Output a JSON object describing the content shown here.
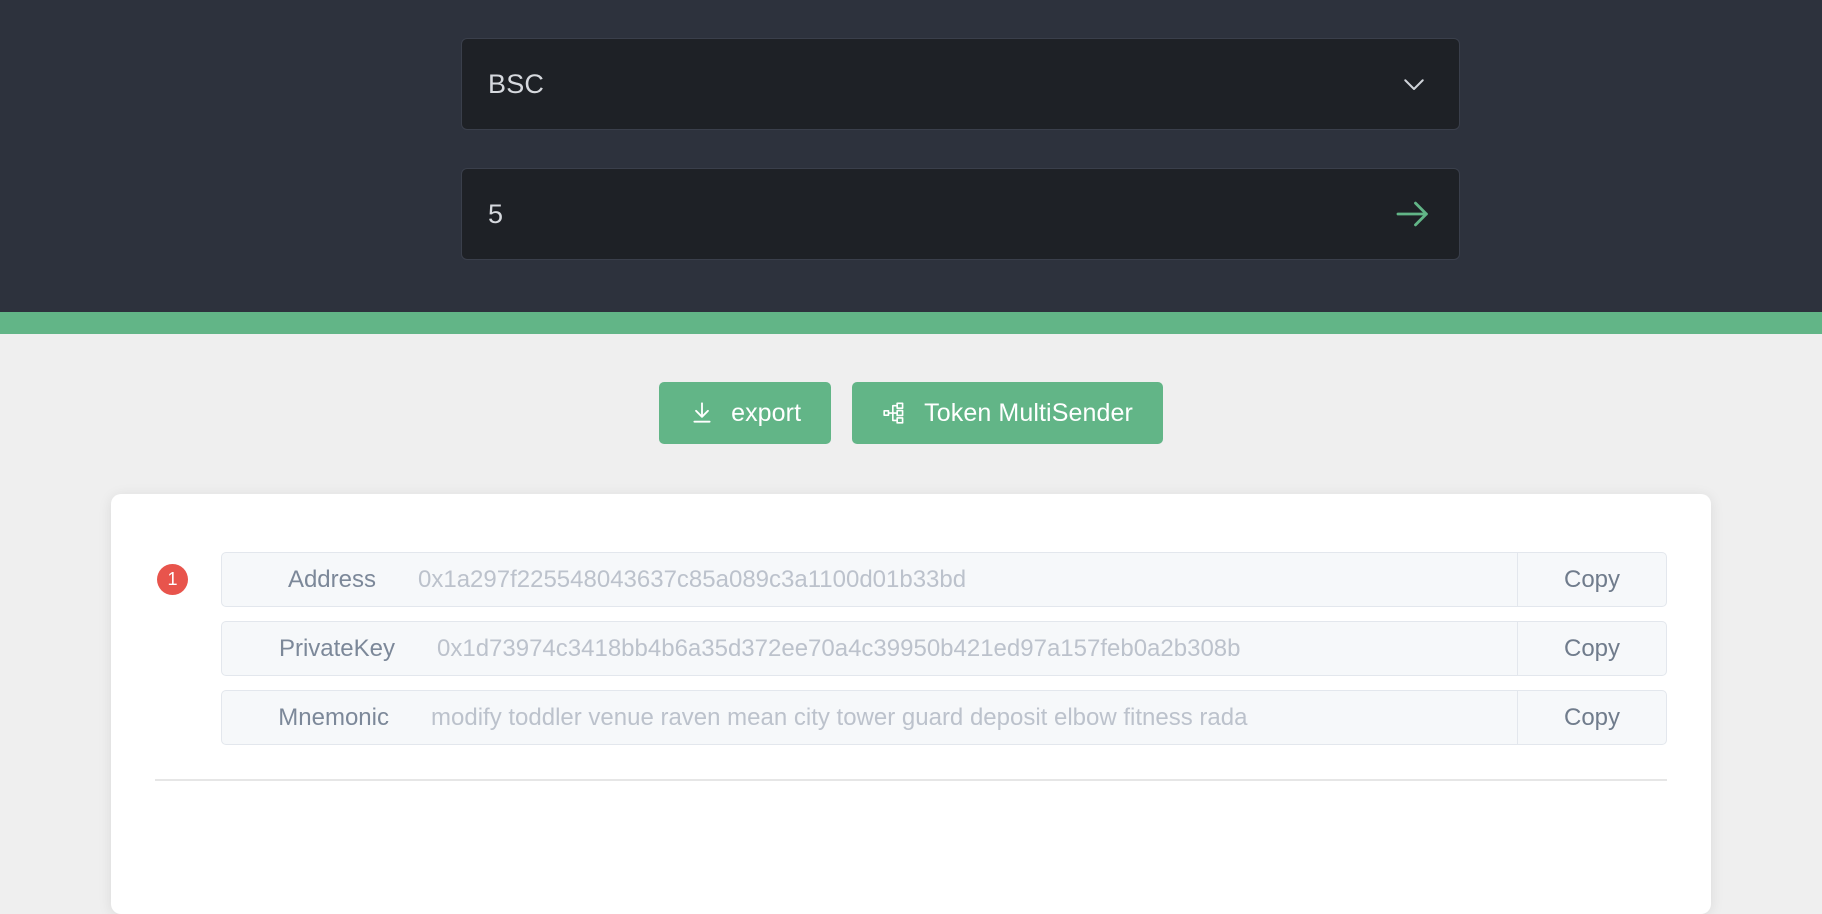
{
  "header": {
    "network_select": {
      "value": "BSC",
      "icon": "chevron-down-icon"
    },
    "count_input": {
      "value": "5",
      "submit_icon": "arrow-right-icon"
    }
  },
  "toolbar": {
    "export_label": "export",
    "export_icon": "download-icon",
    "multisender_label": "Token MultiSender",
    "multisender_icon": "sitemap-icon"
  },
  "wallets": [
    {
      "index": "1",
      "rows": [
        {
          "label": "Address",
          "value": "0x1a297f225548043637c85a089c3a1100d01b33bd",
          "copy_label": "Copy"
        },
        {
          "label": "PrivateKey",
          "value": "0x1d73974c3418bb4b6a35d372ee70a4c39950b421ed97a157feb0a2b308b",
          "copy_label": "Copy"
        },
        {
          "label": "Mnemonic",
          "value": "modify toddler venue raven mean city tower guard deposit elbow fitness rada",
          "copy_label": "Copy"
        }
      ]
    }
  ],
  "colors": {
    "header_bg": "#2d323d",
    "field_bg": "#1e2126",
    "accent_green": "#62b587",
    "badge_red": "#e8544c",
    "page_bg": "#efefef",
    "card_bg": "#ffffff"
  }
}
